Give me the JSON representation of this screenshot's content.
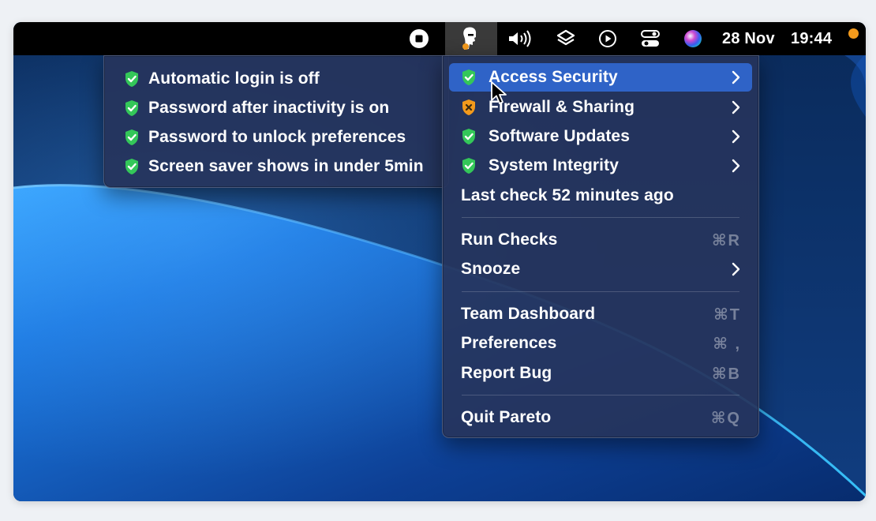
{
  "colors": {
    "menubar_bg": "#000000",
    "menu_bg": "#26345c",
    "highlight": "#2f63c7",
    "shield_ok": "#34c759",
    "shield_warn": "#f39a1c",
    "notification_dot": "#f39a1c"
  },
  "menubar": {
    "icons": [
      "stop-record-icon",
      "pareto-app-icon",
      "volume-icon",
      "layers-icon",
      "play-circle-icon",
      "control-center-icon",
      "siri-icon"
    ],
    "date": "28 Nov",
    "time": "19:44"
  },
  "main_menu": {
    "items": [
      {
        "label": "Access Security",
        "status": "ok",
        "has_submenu": true,
        "highlighted": true
      },
      {
        "label": "Firewall & Sharing",
        "status": "warning",
        "has_submenu": true
      },
      {
        "label": "Software Updates",
        "status": "ok",
        "has_submenu": true
      },
      {
        "label": "System Integrity",
        "status": "ok",
        "has_submenu": true
      }
    ],
    "last_check": "Last check 52 minutes ago",
    "actions": [
      {
        "label": "Run Checks",
        "shortcut": "⌘R"
      },
      {
        "label": "Snooze",
        "has_submenu": true
      }
    ],
    "links": [
      {
        "label": "Team Dashboard",
        "shortcut": "⌘T"
      },
      {
        "label": "Preferences",
        "shortcut": "⌘ ,"
      },
      {
        "label": "Report Bug",
        "shortcut": "⌘B"
      }
    ],
    "quit": {
      "label": "Quit Pareto",
      "shortcut": "⌘Q"
    }
  },
  "sub_menu": {
    "items": [
      {
        "label": "Automatic login is off",
        "status": "ok"
      },
      {
        "label": "Password after inactivity is on",
        "status": "ok"
      },
      {
        "label": "Password to unlock preferences",
        "status": "ok"
      },
      {
        "label": "Screen saver shows in under 5min",
        "status": "ok"
      }
    ]
  }
}
